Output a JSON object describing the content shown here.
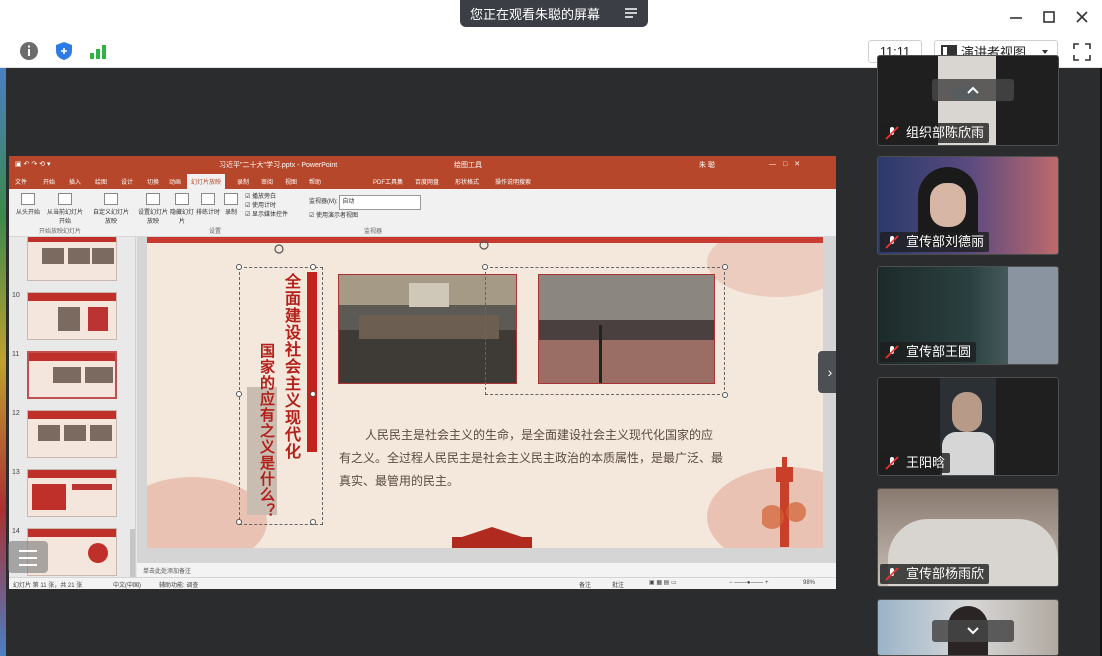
{
  "window": {
    "share_banner": "您正在观看朱聪的屏幕",
    "controls": [
      "minimize-icon",
      "maximize-icon",
      "close-icon"
    ]
  },
  "toolbar": {
    "clock": "11:11",
    "view_label": "演讲者视图",
    "icons": [
      "info-icon",
      "shield-icon",
      "signal-icon",
      "fullscreen-icon"
    ]
  },
  "ppt": {
    "title": "习近平\"二十大\"学习.pptx - PowerPoint",
    "tool_context": "绘图工具",
    "user": "朱 聪",
    "tabs": [
      "文件",
      "开始",
      "插入",
      "绘图",
      "设计",
      "切换",
      "动画",
      "幻灯片放映",
      "录制",
      "审阅",
      "视图",
      "帮助",
      "PDF工具集",
      "百度网盘",
      "形状格式",
      "操作说明搜索"
    ],
    "active_tab": "幻灯片放映",
    "ribbon": {
      "from_start": "从头开始",
      "from_current": "从当前幻灯片开始",
      "custom": "自定义幻灯片放映",
      "setup": "设置幻灯片放映",
      "hide": "隐藏幻灯片",
      "rehearse": "排练计时",
      "record": "录制",
      "play_narrations": "播放旁白",
      "use_timings": "使用计时",
      "show_media": "显示媒体控件",
      "monitor_label": "监视器(M):",
      "monitor_value": "自动",
      "presenter_view": "使用演示者视图",
      "group_start": "开始放映幻灯片",
      "group_setup": "设置",
      "group_monitors": "监视器"
    },
    "thumb_numbers": [
      "10",
      "11",
      "12",
      "13",
      "14"
    ],
    "notes_placeholder": "单击此处添加备注",
    "status": {
      "slide_info": "幻灯片 第 11 张，共 21 张",
      "language": "中文(中国)",
      "accessibility": "辅助功能: 调查",
      "notes": "备注",
      "comments": "批注",
      "zoom": "98%"
    }
  },
  "slide": {
    "title_vertical": "全面建设社会主义现代化",
    "subtitle_vertical": "国家的应有之义是什么？",
    "body": "人民民主是社会主义的生命，是全面建设社会主义现代化国家的应有之义。全过程人民民主是社会主义民主政治的本质属性，是最广泛、最真实、最管用的民主。"
  },
  "participants": [
    {
      "name": "组织部陈欣雨",
      "muted": true
    },
    {
      "name": "宣传部刘德丽",
      "muted": true
    },
    {
      "name": "宣传部王圆",
      "muted": true
    },
    {
      "name": "王阳晗",
      "muted": true
    },
    {
      "name": "宣传部杨雨欣",
      "muted": true
    }
  ],
  "colors": {
    "ppt_accent": "#b7472a",
    "slide_red": "#c0221c",
    "dark_bg": "#2b2c2e"
  }
}
